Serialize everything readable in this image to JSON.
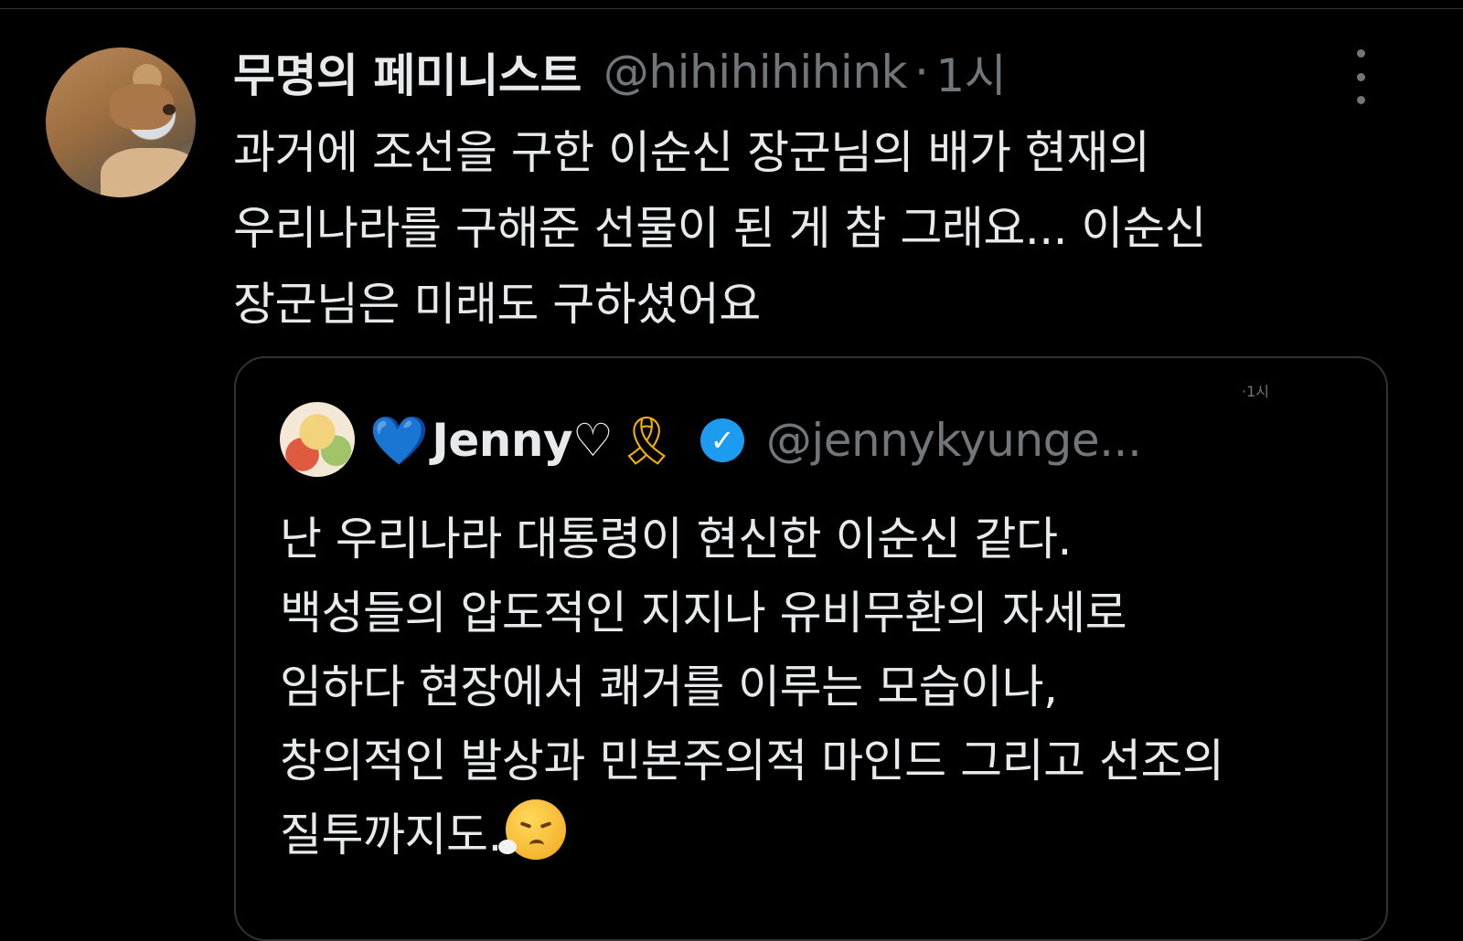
{
  "post": {
    "display_name": "무명의 페미니스트",
    "handle": "@hihihihihink",
    "separator": "·",
    "time": "1시",
    "text_lines": [
      "과거에 조선을 구한 이순신 장군님의 배가 현재의",
      "우리나라를 구해준 선물이 된 게 참 그래요... 이순신",
      "장군님은 미래도 구하셨어요"
    ],
    "avatar_icon": "capybara-avatar",
    "more_icon": "more-vertical-icon"
  },
  "quote": {
    "heart_emoji": "💙",
    "display_name": "Jenny♡",
    "ribbon_emoji": "🎗",
    "verified_icon": "verified-badge-icon",
    "handle": "@jennykyunge...",
    "time": "·1시",
    "text_lines": [
      "난 우리나라 대통령이 현신한 이순신 같다.",
      "백성들의 압도적인 지지나 유비무환의 자세로",
      "임하다 현장에서 쾌거를 이루는 모습이나,",
      "창의적인 발상과 민본주의적 마인드 그리고 선조의",
      "질투까지도."
    ],
    "emoji_name": "face-exhaling-icon",
    "colors": {
      "verified": "#1d9bf0",
      "secondary_text": "#71767b",
      "border": "#2f3336"
    }
  }
}
